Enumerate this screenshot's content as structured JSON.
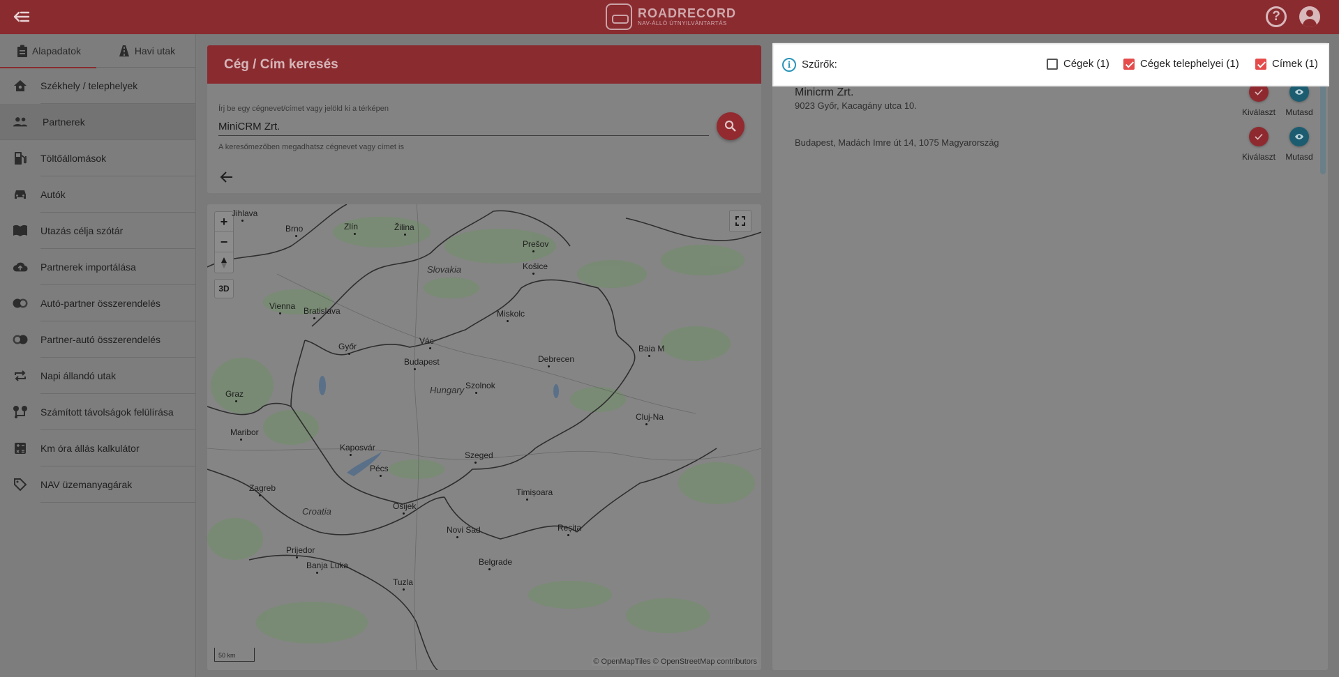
{
  "app": {
    "brand": "ROADRECORD",
    "tagline": "NAV-ÁLLÓ ÚTNYILVÁNTARTÁS",
    "help_glyph": "?",
    "colors": {
      "primary": "#8a2b30",
      "accent_red": "#e54b4b",
      "accent_teal": "#1c5c70",
      "info": "#2a94b8"
    }
  },
  "sidebar": {
    "tabs": [
      {
        "label": "Alapadatok",
        "icon": "clipboard-icon",
        "active": true
      },
      {
        "label": "Havi utak",
        "icon": "road-icon",
        "active": false
      }
    ],
    "items": [
      {
        "label": "Székhely / telephelyek",
        "icon": "home-icon"
      },
      {
        "label": "Partnerek",
        "icon": "people-icon",
        "active": true
      },
      {
        "label": "Töltőállomások",
        "icon": "fuel-icon"
      },
      {
        "label": "Autók",
        "icon": "car-icon"
      },
      {
        "label": "Utazás célja szótár",
        "icon": "book-icon"
      },
      {
        "label": "Partnerek importálása",
        "icon": "cloud-upload-icon"
      },
      {
        "label": "Autó-partner összerendelés",
        "icon": "toggle-icon"
      },
      {
        "label": "Partner-autó összerendelés",
        "icon": "toggle-icon"
      },
      {
        "label": "Napi állandó utak",
        "icon": "repeat-icon"
      },
      {
        "label": "Számított távolságok felülírása",
        "icon": "route-icon"
      },
      {
        "label": "Km óra állás kalkulátor",
        "icon": "calculator-icon"
      },
      {
        "label": "NAV üzemanyagárak",
        "icon": "tag-icon"
      }
    ]
  },
  "search": {
    "title": "Cég / Cím keresés",
    "label": "Írj be egy cégnevet/címet vagy jelöld ki a térképen",
    "value": "MiniCRM Zrt.",
    "hint": "A keresőmezőben megadhatsz cégnevet vagy címet is"
  },
  "map": {
    "controls": {
      "zoom_in": "+",
      "zoom_out": "−",
      "three_d": "3D"
    },
    "scale": "50 km",
    "attribution": "© OpenMapTiles © OpenStreetMap contributors",
    "labels": [
      {
        "text": "Jihlava"
      },
      {
        "text": "Brno"
      },
      {
        "text": "Zlín"
      },
      {
        "text": "Žilina"
      },
      {
        "text": "Prešov"
      },
      {
        "text": "Košice"
      },
      {
        "text": "Slovakia",
        "country": true
      },
      {
        "text": "Vienna"
      },
      {
        "text": "Bratislava"
      },
      {
        "text": "Miskolc"
      },
      {
        "text": "Győr"
      },
      {
        "text": "Vác"
      },
      {
        "text": "Budapest"
      },
      {
        "text": "Debrecen"
      },
      {
        "text": "Baia M"
      },
      {
        "text": "Hungary",
        "country": true
      },
      {
        "text": "Szolnok"
      },
      {
        "text": "Graz"
      },
      {
        "text": "Cluj-Na"
      },
      {
        "text": "Maribor"
      },
      {
        "text": "Kaposvár"
      },
      {
        "text": "Szeged"
      },
      {
        "text": "Pécs"
      },
      {
        "text": "Zagreb"
      },
      {
        "text": "Timișoara"
      },
      {
        "text": "Croatia",
        "country": true
      },
      {
        "text": "Osijek"
      },
      {
        "text": "Novi Sad"
      },
      {
        "text": "Reșița"
      },
      {
        "text": "Prijedor"
      },
      {
        "text": "Banja Luka"
      },
      {
        "text": "Belgrade"
      },
      {
        "text": "Tuzla"
      }
    ]
  },
  "filters": {
    "title": "Szűrők:",
    "options": [
      {
        "label": "Cégek (1)",
        "checked": false
      },
      {
        "label": "Cégek telephelyei (1)",
        "checked": true
      },
      {
        "label": "Címek (1)",
        "checked": true
      }
    ]
  },
  "results": [
    {
      "title": "Minicrm Zrt.",
      "address": "9023 Győr, Kacagány utca 10.",
      "select_label": "Kiválaszt",
      "show_label": "Mutasd"
    },
    {
      "title": "",
      "address": "Budapest, Madách Imre út 14, 1075 Magyarország",
      "select_label": "Kiválaszt",
      "show_label": "Mutasd"
    }
  ]
}
